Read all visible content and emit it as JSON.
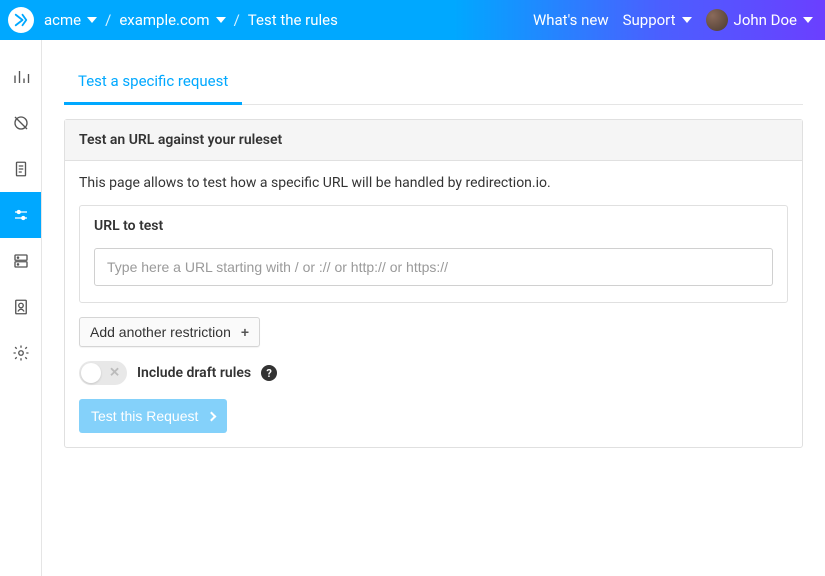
{
  "header": {
    "breadcrumb": [
      "acme",
      "example.com",
      "Test the rules"
    ],
    "whats_new": "What's new",
    "support": "Support",
    "username": "John Doe"
  },
  "tabs": {
    "active": "Test a specific request"
  },
  "panel": {
    "title": "Test an URL against your ruleset",
    "intro": "This page allows to test how a specific URL will be handled by redirection.io.",
    "url_label": "URL to test",
    "url_placeholder": "Type here a URL starting with / or :// or http:// or https://",
    "add_restriction": "Add another restriction",
    "include_draft": "Include draft rules",
    "test_button": "Test this Request"
  }
}
